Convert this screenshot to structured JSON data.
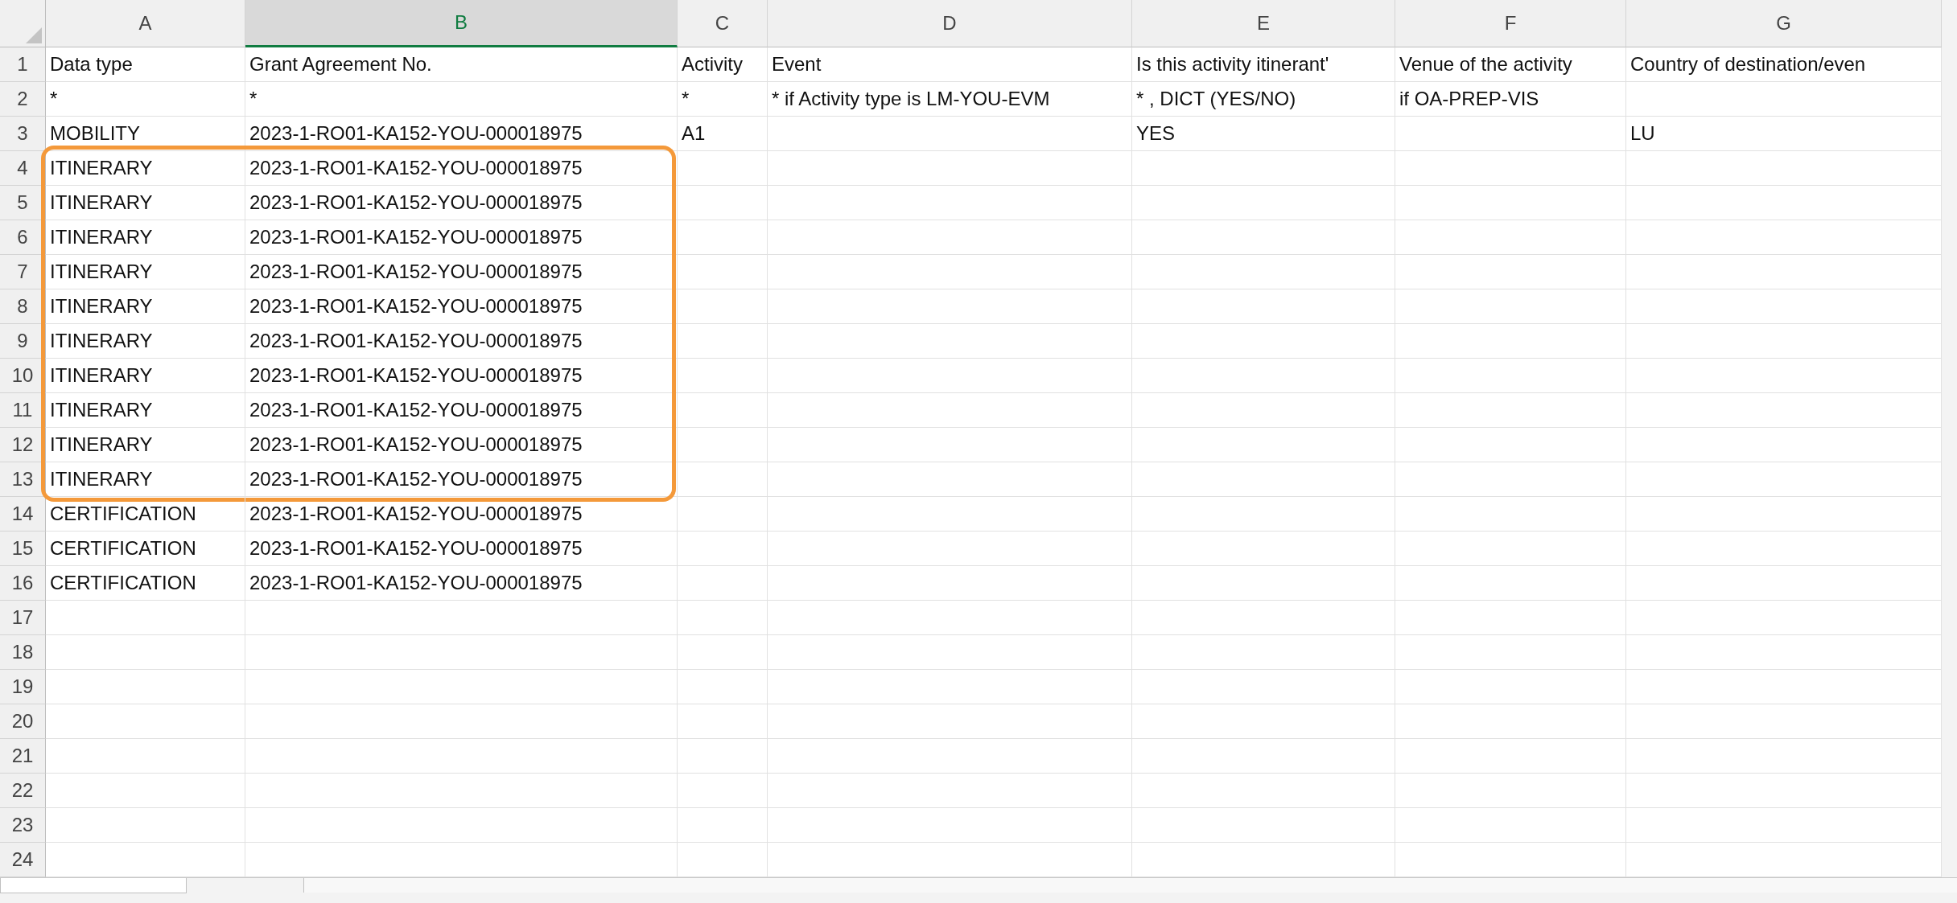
{
  "columns": [
    {
      "label": "A",
      "selected": false
    },
    {
      "label": "B",
      "selected": true
    },
    {
      "label": "C",
      "selected": false
    },
    {
      "label": "D",
      "selected": false
    },
    {
      "label": "E",
      "selected": false
    },
    {
      "label": "F",
      "selected": false
    },
    {
      "label": "G",
      "selected": false
    }
  ],
  "rows": [
    {
      "number": "1",
      "outlined": false,
      "cells": {
        "A": "Data type",
        "B": "Grant Agreement No.",
        "C": "Activity",
        "D": "Event",
        "E": "Is this activity itinerant'",
        "F": "Venue of the activity",
        "G": "Country of destination/even"
      }
    },
    {
      "number": "2",
      "outlined": false,
      "cells": {
        "A": "*",
        "B": "*",
        "C": "*",
        "D": "* if Activity type is LM-YOU-EVM",
        "E": "* , DICT (YES/NO)",
        "F": "if OA-PREP-VIS"
      }
    },
    {
      "number": "3",
      "outlined": false,
      "cells": {
        "A": "MOBILITY",
        "B": "2023-1-RO01-KA152-YOU-000018975",
        "C": "A1",
        "E": "YES",
        "G": "LU"
      }
    },
    {
      "number": "4",
      "outlined": true,
      "cells": {
        "A": "ITINERARY",
        "B": "2023-1-RO01-KA152-YOU-000018975"
      }
    },
    {
      "number": "5",
      "outlined": true,
      "cells": {
        "A": "ITINERARY",
        "B": "2023-1-RO01-KA152-YOU-000018975"
      }
    },
    {
      "number": "6",
      "outlined": true,
      "cells": {
        "A": "ITINERARY",
        "B": "2023-1-RO01-KA152-YOU-000018975"
      }
    },
    {
      "number": "7",
      "outlined": true,
      "cells": {
        "A": "ITINERARY",
        "B": "2023-1-RO01-KA152-YOU-000018975"
      }
    },
    {
      "number": "8",
      "outlined": true,
      "cells": {
        "A": "ITINERARY",
        "B": "2023-1-RO01-KA152-YOU-000018975"
      }
    },
    {
      "number": "9",
      "outlined": true,
      "cells": {
        "A": "ITINERARY",
        "B": "2023-1-RO01-KA152-YOU-000018975"
      }
    },
    {
      "number": "10",
      "outlined": true,
      "cells": {
        "A": "ITINERARY",
        "B": "2023-1-RO01-KA152-YOU-000018975"
      }
    },
    {
      "number": "11",
      "outlined": true,
      "cells": {
        "A": "ITINERARY",
        "B": "2023-1-RO01-KA152-YOU-000018975"
      }
    },
    {
      "number": "12",
      "outlined": true,
      "cells": {
        "A": "ITINERARY",
        "B": "2023-1-RO01-KA152-YOU-000018975"
      }
    },
    {
      "number": "13",
      "outlined": true,
      "cells": {
        "A": "ITINERARY",
        "B": "2023-1-RO01-KA152-YOU-000018975"
      }
    },
    {
      "number": "14",
      "outlined": false,
      "cells": {
        "A": "CERTIFICATION",
        "B": "2023-1-RO01-KA152-YOU-000018975"
      }
    },
    {
      "number": "15",
      "outlined": false,
      "cells": {
        "A": "CERTIFICATION",
        "B": "2023-1-RO01-KA152-YOU-000018975"
      }
    },
    {
      "number": "16",
      "outlined": false,
      "cells": {
        "A": "CERTIFICATION",
        "B": "2023-1-RO01-KA152-YOU-000018975"
      }
    },
    {
      "number": "17",
      "outlined": false
    },
    {
      "number": "18",
      "outlined": false
    },
    {
      "number": "19",
      "outlined": false
    },
    {
      "number": "20",
      "outlined": false
    },
    {
      "number": "21",
      "outlined": false
    },
    {
      "number": "22",
      "outlined": false
    },
    {
      "number": "23",
      "outlined": false
    },
    {
      "number": "24",
      "outlined": false
    }
  ]
}
